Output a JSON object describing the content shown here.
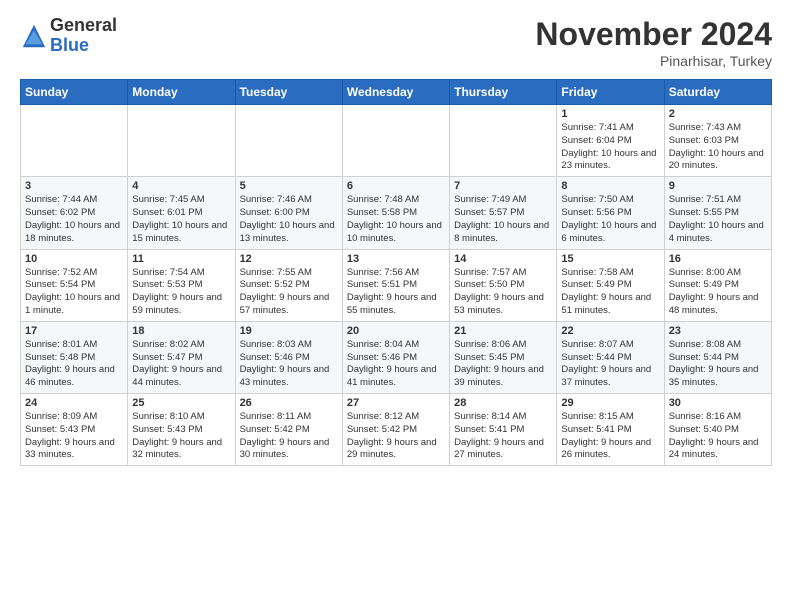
{
  "logo": {
    "general": "General",
    "blue": "Blue"
  },
  "title": "November 2024",
  "location": "Pinarhisar, Turkey",
  "days_of_week": [
    "Sunday",
    "Monday",
    "Tuesday",
    "Wednesday",
    "Thursday",
    "Friday",
    "Saturday"
  ],
  "weeks": [
    [
      {
        "day": "",
        "info": ""
      },
      {
        "day": "",
        "info": ""
      },
      {
        "day": "",
        "info": ""
      },
      {
        "day": "",
        "info": ""
      },
      {
        "day": "",
        "info": ""
      },
      {
        "day": "1",
        "info": "Sunrise: 7:41 AM\nSunset: 6:04 PM\nDaylight: 10 hours and 23 minutes."
      },
      {
        "day": "2",
        "info": "Sunrise: 7:43 AM\nSunset: 6:03 PM\nDaylight: 10 hours and 20 minutes."
      }
    ],
    [
      {
        "day": "3",
        "info": "Sunrise: 7:44 AM\nSunset: 6:02 PM\nDaylight: 10 hours and 18 minutes."
      },
      {
        "day": "4",
        "info": "Sunrise: 7:45 AM\nSunset: 6:01 PM\nDaylight: 10 hours and 15 minutes."
      },
      {
        "day": "5",
        "info": "Sunrise: 7:46 AM\nSunset: 6:00 PM\nDaylight: 10 hours and 13 minutes."
      },
      {
        "day": "6",
        "info": "Sunrise: 7:48 AM\nSunset: 5:58 PM\nDaylight: 10 hours and 10 minutes."
      },
      {
        "day": "7",
        "info": "Sunrise: 7:49 AM\nSunset: 5:57 PM\nDaylight: 10 hours and 8 minutes."
      },
      {
        "day": "8",
        "info": "Sunrise: 7:50 AM\nSunset: 5:56 PM\nDaylight: 10 hours and 6 minutes."
      },
      {
        "day": "9",
        "info": "Sunrise: 7:51 AM\nSunset: 5:55 PM\nDaylight: 10 hours and 4 minutes."
      }
    ],
    [
      {
        "day": "10",
        "info": "Sunrise: 7:52 AM\nSunset: 5:54 PM\nDaylight: 10 hours and 1 minute."
      },
      {
        "day": "11",
        "info": "Sunrise: 7:54 AM\nSunset: 5:53 PM\nDaylight: 9 hours and 59 minutes."
      },
      {
        "day": "12",
        "info": "Sunrise: 7:55 AM\nSunset: 5:52 PM\nDaylight: 9 hours and 57 minutes."
      },
      {
        "day": "13",
        "info": "Sunrise: 7:56 AM\nSunset: 5:51 PM\nDaylight: 9 hours and 55 minutes."
      },
      {
        "day": "14",
        "info": "Sunrise: 7:57 AM\nSunset: 5:50 PM\nDaylight: 9 hours and 53 minutes."
      },
      {
        "day": "15",
        "info": "Sunrise: 7:58 AM\nSunset: 5:49 PM\nDaylight: 9 hours and 51 minutes."
      },
      {
        "day": "16",
        "info": "Sunrise: 8:00 AM\nSunset: 5:49 PM\nDaylight: 9 hours and 48 minutes."
      }
    ],
    [
      {
        "day": "17",
        "info": "Sunrise: 8:01 AM\nSunset: 5:48 PM\nDaylight: 9 hours and 46 minutes."
      },
      {
        "day": "18",
        "info": "Sunrise: 8:02 AM\nSunset: 5:47 PM\nDaylight: 9 hours and 44 minutes."
      },
      {
        "day": "19",
        "info": "Sunrise: 8:03 AM\nSunset: 5:46 PM\nDaylight: 9 hours and 43 minutes."
      },
      {
        "day": "20",
        "info": "Sunrise: 8:04 AM\nSunset: 5:46 PM\nDaylight: 9 hours and 41 minutes."
      },
      {
        "day": "21",
        "info": "Sunrise: 8:06 AM\nSunset: 5:45 PM\nDaylight: 9 hours and 39 minutes."
      },
      {
        "day": "22",
        "info": "Sunrise: 8:07 AM\nSunset: 5:44 PM\nDaylight: 9 hours and 37 minutes."
      },
      {
        "day": "23",
        "info": "Sunrise: 8:08 AM\nSunset: 5:44 PM\nDaylight: 9 hours and 35 minutes."
      }
    ],
    [
      {
        "day": "24",
        "info": "Sunrise: 8:09 AM\nSunset: 5:43 PM\nDaylight: 9 hours and 33 minutes."
      },
      {
        "day": "25",
        "info": "Sunrise: 8:10 AM\nSunset: 5:43 PM\nDaylight: 9 hours and 32 minutes."
      },
      {
        "day": "26",
        "info": "Sunrise: 8:11 AM\nSunset: 5:42 PM\nDaylight: 9 hours and 30 minutes."
      },
      {
        "day": "27",
        "info": "Sunrise: 8:12 AM\nSunset: 5:42 PM\nDaylight: 9 hours and 29 minutes."
      },
      {
        "day": "28",
        "info": "Sunrise: 8:14 AM\nSunset: 5:41 PM\nDaylight: 9 hours and 27 minutes."
      },
      {
        "day": "29",
        "info": "Sunrise: 8:15 AM\nSunset: 5:41 PM\nDaylight: 9 hours and 26 minutes."
      },
      {
        "day": "30",
        "info": "Sunrise: 8:16 AM\nSunset: 5:40 PM\nDaylight: 9 hours and 24 minutes."
      }
    ]
  ]
}
